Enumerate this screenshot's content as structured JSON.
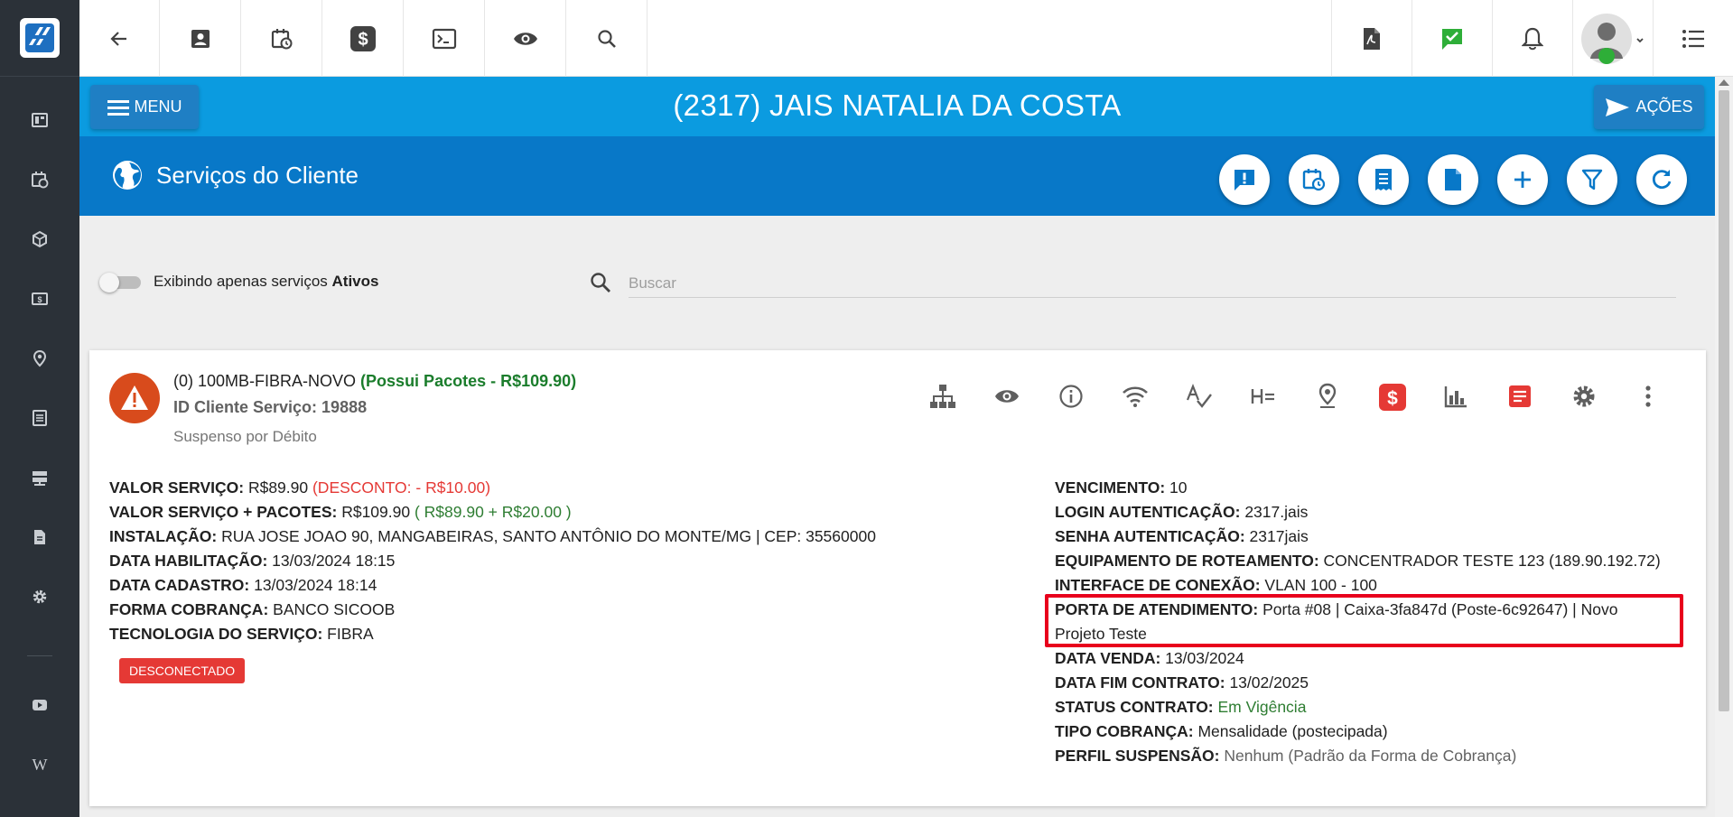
{
  "colors": {
    "primary_blue": "#0b9be0",
    "dark_blue": "#0878c8",
    "sidebar": "#2b3138",
    "warning": "#d84b1c",
    "danger": "#e53935",
    "success": "#2e7d32"
  },
  "topbar": {
    "icons": [
      "back-arrow-icon",
      "contact-card-icon",
      "calendar-clock-icon",
      "dollar-icon",
      "terminal-icon",
      "eye-icon",
      "search-icon",
      "pdf-icon",
      "chat-check-icon",
      "bell-icon",
      "user-avatar",
      "list-icon"
    ]
  },
  "sidebar": {
    "icons": [
      "dashboard-icon",
      "calendar-clock-icon",
      "box-icon",
      "money-icon",
      "map-pin-icon",
      "list-icon",
      "server-icon",
      "document-icon",
      "gear-icon",
      "youtube-icon",
      "wiki-icon"
    ],
    "wiki_label": "W"
  },
  "header": {
    "menu_label": "MENU",
    "client_title": "(2317) JAIS NATALIA DA COSTA",
    "actions_label": "AÇÕES"
  },
  "section": {
    "title": "Serviços do Cliente"
  },
  "filter": {
    "toggle_text": "Exibindo apenas serviços ",
    "toggle_bold": "Ativos",
    "toggle_on": false,
    "search_placeholder": "Buscar"
  },
  "service": {
    "name": "(0) 100MB-FIBRA-NOVO ",
    "packages_text": "(Possui Pacotes - R$109.90)",
    "id_text": "ID Cliente Serviço: 19888",
    "status": "Suspenso por Débito",
    "connection_badge": "DESCONECTADO",
    "left": [
      {
        "label": "VALOR SERVIÇO:",
        "value": " R$89.90 ",
        "extra": "(DESCONTO: - R$10.00)",
        "extra_color": "red"
      },
      {
        "label": "VALOR SERVIÇO + PACOTES:",
        "value": " R$109.90 ",
        "extra": "( R$89.90 + R$20.00 )",
        "extra_color": "green"
      },
      {
        "label": "INSTALAÇÃO:",
        "value": " RUA JOSE JOAO 90, MANGABEIRAS, SANTO ANTÔNIO DO MONTE/MG | CEP: 35560000"
      },
      {
        "label": "DATA HABILITAÇÃO:",
        "value": " 13/03/2024 18:15"
      },
      {
        "label": "DATA CADASTRO:",
        "value": " 13/03/2024 18:14"
      },
      {
        "label": "FORMA COBRANÇA:",
        "value": " BANCO SICOOB"
      },
      {
        "label": "TECNOLOGIA DO SERVIÇO:",
        "value": " FIBRA"
      }
    ],
    "right": [
      {
        "label": "VENCIMENTO:",
        "value": " 10"
      },
      {
        "label": "LOGIN AUTENTICAÇÃO:",
        "value": " 2317.jais"
      },
      {
        "label": "SENHA AUTENTICAÇÃO:",
        "value": " 2317jais"
      },
      {
        "label": "EQUIPAMENTO DE ROTEAMENTO:",
        "value": " CONCENTRADOR TESTE 123 (189.90.192.72)"
      },
      {
        "label": "INTERFACE DE CONEXÃO:",
        "value": " VLAN 100 - 100"
      },
      {
        "label": "PORTA DE ATENDIMENTO:",
        "value": " Porta #08 | Caixa-3fa847d (Poste-6c92647) | Novo",
        "value2": "Projeto Teste"
      },
      {
        "label": "DATA VENDA:",
        "value": " 13/03/2024"
      },
      {
        "label": "DATA FIM CONTRATO:",
        "value": " 13/02/2025"
      },
      {
        "label": "STATUS CONTRATO:",
        "value": " Em Vigência",
        "value_color": "green"
      },
      {
        "label": "TIPO COBRANÇA:",
        "value": " Mensalidade (postecipada)"
      },
      {
        "label": "PERFIL SUSPENSÃO:",
        "value": " Nenhum (Padrão da Forma de Cobrança)",
        "value_color": "grey"
      }
    ]
  }
}
